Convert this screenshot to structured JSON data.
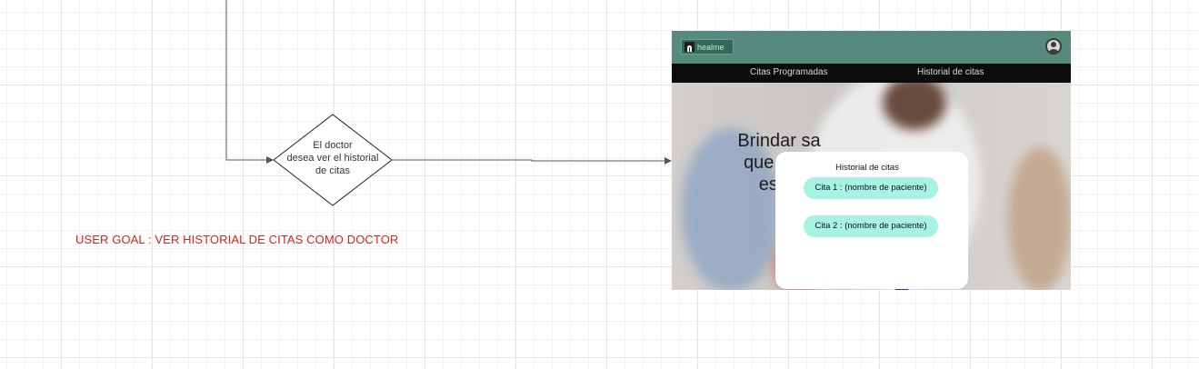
{
  "decision": {
    "lines": [
      "El doctor",
      "desea ver el historial",
      "de citas"
    ]
  },
  "user_goal": "USER GOAL : VER HISTORIAL DE CITAS COMO DOCTOR",
  "mockup": {
    "logo_text": "healme",
    "nav": [
      "Citas Programadas",
      "Historial de citas"
    ],
    "hero_lines": [
      "Brindar sa",
      "que no p",
      "es ur"
    ],
    "modal": {
      "title": "Historial de citas",
      "items": [
        "Cita 1 : (nombre de paciente)",
        "Cita 2 : (nombre de paciente)"
      ]
    }
  },
  "colors": {
    "header": "#568a7c",
    "nav": "#0c0c0c",
    "cita_pill": "#a6f3e4",
    "goal_text": "#e0201b"
  }
}
